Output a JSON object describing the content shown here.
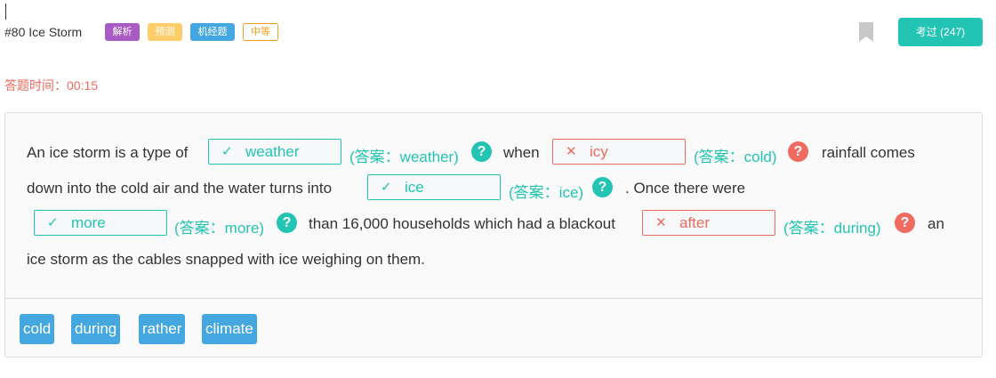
{
  "header": {
    "title": "#80 Ice Storm",
    "tags": [
      "解析",
      "预测",
      "机经题",
      "中等"
    ],
    "done_button": "考过 (247)"
  },
  "timer": "答题时间：00:15",
  "passage": {
    "t1": "An ice storm is a type of",
    "t2": "when",
    "t3": "rainfall comes",
    "t4": "down into the cold air and the water turns into",
    "t5": ". Once there were",
    "t6": "than 16,000 households which had a blackout",
    "t7": "an",
    "t8": "ice storm as the cables snapped with ice weighing on them."
  },
  "blanks": [
    {
      "mark": "✓",
      "value": "weather",
      "answer": "(答案：weather)",
      "status": "correct"
    },
    {
      "mark": "✕",
      "value": "icy",
      "answer": "(答案：cold)",
      "status": "wrong"
    },
    {
      "mark": "✓",
      "value": "ice",
      "answer": "(答案：ice)",
      "status": "correct"
    },
    {
      "mark": "✓",
      "value": "more",
      "answer": "(答案：more)",
      "status": "correct"
    },
    {
      "mark": "✕",
      "value": "after",
      "answer": "(答案：during)",
      "status": "wrong"
    }
  ],
  "help_glyph": "?",
  "word_bank": [
    "cold",
    "during",
    "rather",
    "climate"
  ],
  "colors": {
    "accent": "#23c4b3",
    "error": "#ef6b5f",
    "chip": "#45a7e0",
    "tag_analysis": "#a85bc3",
    "tag_predict": "#ffce6a",
    "tag_machine": "#45a7e0",
    "tag_level": "#f0a020"
  }
}
